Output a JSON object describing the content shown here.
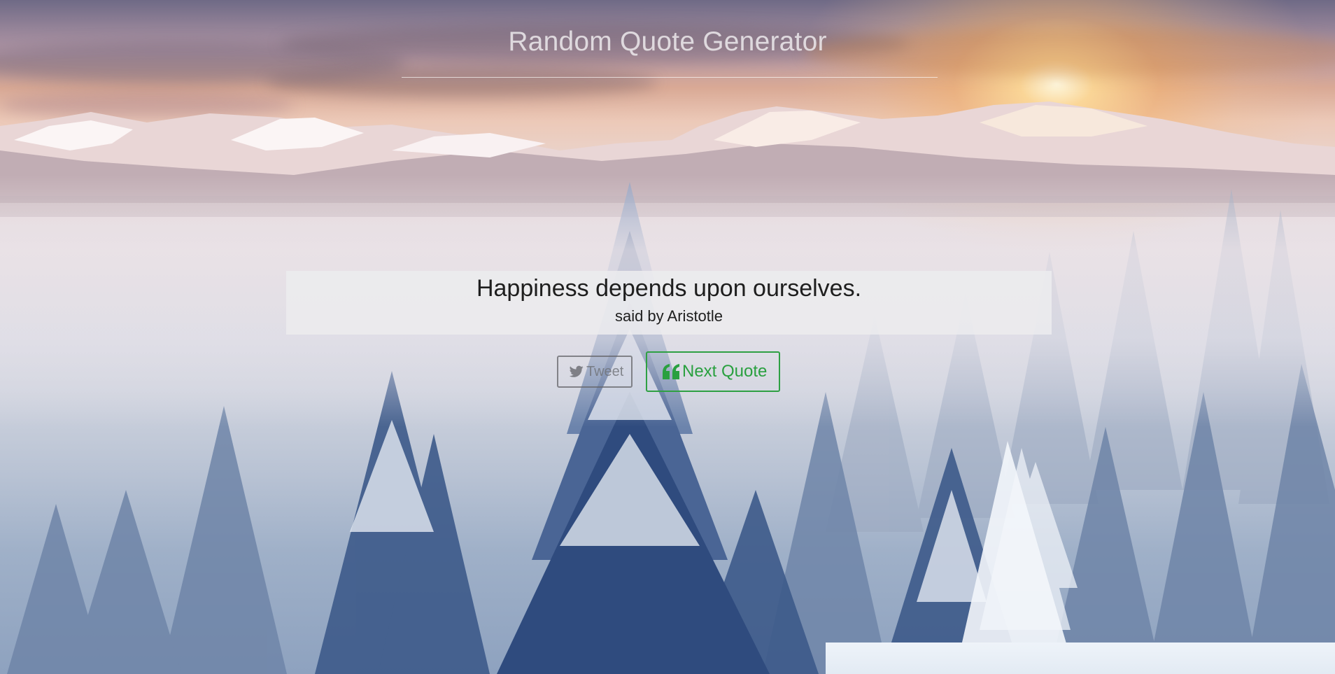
{
  "app": {
    "title": "Random Quote Generator"
  },
  "quote": {
    "text": "Happiness depends upon ourselves.",
    "author": "said by Aristotle"
  },
  "actions": {
    "tweet_label": "Tweet",
    "tweet_icon": "twitter-icon",
    "next_label": "Next Quote",
    "next_icon": "quote-left-icon"
  },
  "theme": {
    "accent": "#2ea043",
    "card_background": "#ececee",
    "text_color": "#1e1e1e"
  }
}
